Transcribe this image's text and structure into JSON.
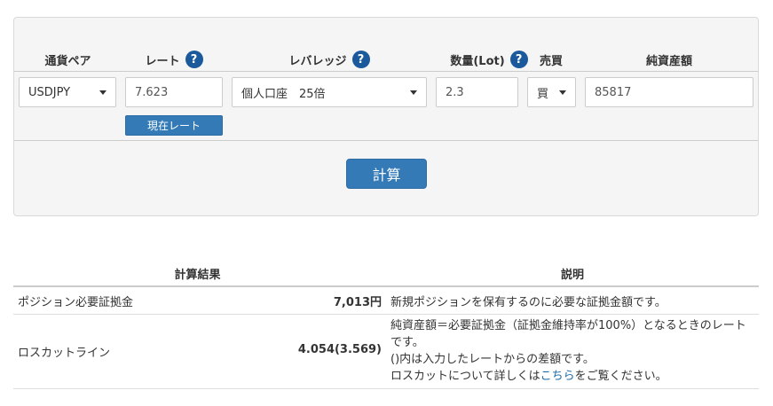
{
  "form": {
    "headers": {
      "pair": "通貨ペア",
      "rate": "レート",
      "leverage": "レバレッジ",
      "quantity": "数量(Lot)",
      "side": "売買",
      "equity": "純資産額"
    },
    "help_glyph": "?",
    "pair_value": "USDJPY",
    "rate_value": "7.623",
    "current_rate_label": "現在レート",
    "leverage_value": "個人口座　25倍",
    "quantity_value": "2.3",
    "side_value": "買",
    "equity_value": "85817",
    "calculate_label": "計算"
  },
  "results": {
    "headers": {
      "result": "計算結果",
      "description": "説明"
    },
    "rows": [
      {
        "label": "ポジション必要証拠金",
        "value": "7,013円",
        "description": "新規ポジションを保有するのに必要な証拠金額です。"
      },
      {
        "label": "ロスカットライン",
        "value": "4.054(3.569)",
        "description_line1": "純資産額＝必要証拠金（証拠金維持率が100%）となるときのレートです。",
        "description_line2": "()内は入力したレートからの差額です。",
        "description_line3_prefix": "ロスカットについて詳しくは",
        "description_link": "こちら",
        "description_line3_suffix": "をご覧ください。"
      }
    ]
  },
  "colors": {
    "accent": "#337ab7",
    "help_badge": "#1a5a9c",
    "link": "#1a6aa8",
    "panel_bg": "#f5f5f5"
  }
}
